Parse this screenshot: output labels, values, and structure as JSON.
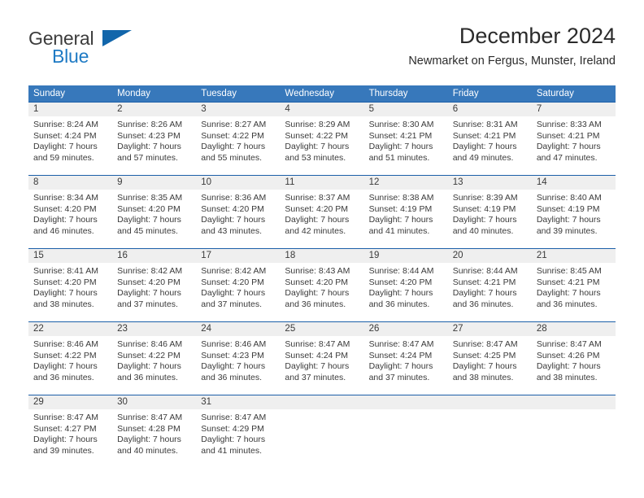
{
  "brand": {
    "name_part1": "General",
    "name_part2": "Blue",
    "triangle_color": "#1266ab",
    "blue_color": "#1e7ac4"
  },
  "header": {
    "title": "December 2024",
    "subtitle": "Newmarket on Fergus, Munster, Ireland"
  },
  "theme": {
    "header_blue": "#3778bb",
    "rule_blue": "#1c5fa8",
    "date_band_gray": "#efefef"
  },
  "weekdays": [
    "Sunday",
    "Monday",
    "Tuesday",
    "Wednesday",
    "Thursday",
    "Friday",
    "Saturday"
  ],
  "weeks": [
    [
      {
        "day": "1",
        "l1": "Sunrise: 8:24 AM",
        "l2": "Sunset: 4:24 PM",
        "l3": "Daylight: 7 hours",
        "l4": "and 59 minutes."
      },
      {
        "day": "2",
        "l1": "Sunrise: 8:26 AM",
        "l2": "Sunset: 4:23 PM",
        "l3": "Daylight: 7 hours",
        "l4": "and 57 minutes."
      },
      {
        "day": "3",
        "l1": "Sunrise: 8:27 AM",
        "l2": "Sunset: 4:22 PM",
        "l3": "Daylight: 7 hours",
        "l4": "and 55 minutes."
      },
      {
        "day": "4",
        "l1": "Sunrise: 8:29 AM",
        "l2": "Sunset: 4:22 PM",
        "l3": "Daylight: 7 hours",
        "l4": "and 53 minutes."
      },
      {
        "day": "5",
        "l1": "Sunrise: 8:30 AM",
        "l2": "Sunset: 4:21 PM",
        "l3": "Daylight: 7 hours",
        "l4": "and 51 minutes."
      },
      {
        "day": "6",
        "l1": "Sunrise: 8:31 AM",
        "l2": "Sunset: 4:21 PM",
        "l3": "Daylight: 7 hours",
        "l4": "and 49 minutes."
      },
      {
        "day": "7",
        "l1": "Sunrise: 8:33 AM",
        "l2": "Sunset: 4:21 PM",
        "l3": "Daylight: 7 hours",
        "l4": "and 47 minutes."
      }
    ],
    [
      {
        "day": "8",
        "l1": "Sunrise: 8:34 AM",
        "l2": "Sunset: 4:20 PM",
        "l3": "Daylight: 7 hours",
        "l4": "and 46 minutes."
      },
      {
        "day": "9",
        "l1": "Sunrise: 8:35 AM",
        "l2": "Sunset: 4:20 PM",
        "l3": "Daylight: 7 hours",
        "l4": "and 45 minutes."
      },
      {
        "day": "10",
        "l1": "Sunrise: 8:36 AM",
        "l2": "Sunset: 4:20 PM",
        "l3": "Daylight: 7 hours",
        "l4": "and 43 minutes."
      },
      {
        "day": "11",
        "l1": "Sunrise: 8:37 AM",
        "l2": "Sunset: 4:20 PM",
        "l3": "Daylight: 7 hours",
        "l4": "and 42 minutes."
      },
      {
        "day": "12",
        "l1": "Sunrise: 8:38 AM",
        "l2": "Sunset: 4:19 PM",
        "l3": "Daylight: 7 hours",
        "l4": "and 41 minutes."
      },
      {
        "day": "13",
        "l1": "Sunrise: 8:39 AM",
        "l2": "Sunset: 4:19 PM",
        "l3": "Daylight: 7 hours",
        "l4": "and 40 minutes."
      },
      {
        "day": "14",
        "l1": "Sunrise: 8:40 AM",
        "l2": "Sunset: 4:19 PM",
        "l3": "Daylight: 7 hours",
        "l4": "and 39 minutes."
      }
    ],
    [
      {
        "day": "15",
        "l1": "Sunrise: 8:41 AM",
        "l2": "Sunset: 4:20 PM",
        "l3": "Daylight: 7 hours",
        "l4": "and 38 minutes."
      },
      {
        "day": "16",
        "l1": "Sunrise: 8:42 AM",
        "l2": "Sunset: 4:20 PM",
        "l3": "Daylight: 7 hours",
        "l4": "and 37 minutes."
      },
      {
        "day": "17",
        "l1": "Sunrise: 8:42 AM",
        "l2": "Sunset: 4:20 PM",
        "l3": "Daylight: 7 hours",
        "l4": "and 37 minutes."
      },
      {
        "day": "18",
        "l1": "Sunrise: 8:43 AM",
        "l2": "Sunset: 4:20 PM",
        "l3": "Daylight: 7 hours",
        "l4": "and 36 minutes."
      },
      {
        "day": "19",
        "l1": "Sunrise: 8:44 AM",
        "l2": "Sunset: 4:20 PM",
        "l3": "Daylight: 7 hours",
        "l4": "and 36 minutes."
      },
      {
        "day": "20",
        "l1": "Sunrise: 8:44 AM",
        "l2": "Sunset: 4:21 PM",
        "l3": "Daylight: 7 hours",
        "l4": "and 36 minutes."
      },
      {
        "day": "21",
        "l1": "Sunrise: 8:45 AM",
        "l2": "Sunset: 4:21 PM",
        "l3": "Daylight: 7 hours",
        "l4": "and 36 minutes."
      }
    ],
    [
      {
        "day": "22",
        "l1": "Sunrise: 8:46 AM",
        "l2": "Sunset: 4:22 PM",
        "l3": "Daylight: 7 hours",
        "l4": "and 36 minutes."
      },
      {
        "day": "23",
        "l1": "Sunrise: 8:46 AM",
        "l2": "Sunset: 4:22 PM",
        "l3": "Daylight: 7 hours",
        "l4": "and 36 minutes."
      },
      {
        "day": "24",
        "l1": "Sunrise: 8:46 AM",
        "l2": "Sunset: 4:23 PM",
        "l3": "Daylight: 7 hours",
        "l4": "and 36 minutes."
      },
      {
        "day": "25",
        "l1": "Sunrise: 8:47 AM",
        "l2": "Sunset: 4:24 PM",
        "l3": "Daylight: 7 hours",
        "l4": "and 37 minutes."
      },
      {
        "day": "26",
        "l1": "Sunrise: 8:47 AM",
        "l2": "Sunset: 4:24 PM",
        "l3": "Daylight: 7 hours",
        "l4": "and 37 minutes."
      },
      {
        "day": "27",
        "l1": "Sunrise: 8:47 AM",
        "l2": "Sunset: 4:25 PM",
        "l3": "Daylight: 7 hours",
        "l4": "and 38 minutes."
      },
      {
        "day": "28",
        "l1": "Sunrise: 8:47 AM",
        "l2": "Sunset: 4:26 PM",
        "l3": "Daylight: 7 hours",
        "l4": "and 38 minutes."
      }
    ],
    [
      {
        "day": "29",
        "l1": "Sunrise: 8:47 AM",
        "l2": "Sunset: 4:27 PM",
        "l3": "Daylight: 7 hours",
        "l4": "and 39 minutes."
      },
      {
        "day": "30",
        "l1": "Sunrise: 8:47 AM",
        "l2": "Sunset: 4:28 PM",
        "l3": "Daylight: 7 hours",
        "l4": "and 40 minutes."
      },
      {
        "day": "31",
        "l1": "Sunrise: 8:47 AM",
        "l2": "Sunset: 4:29 PM",
        "l3": "Daylight: 7 hours",
        "l4": "and 41 minutes."
      },
      {
        "day": "",
        "l1": "",
        "l2": "",
        "l3": "",
        "l4": ""
      },
      {
        "day": "",
        "l1": "",
        "l2": "",
        "l3": "",
        "l4": ""
      },
      {
        "day": "",
        "l1": "",
        "l2": "",
        "l3": "",
        "l4": ""
      },
      {
        "day": "",
        "l1": "",
        "l2": "",
        "l3": "",
        "l4": ""
      }
    ]
  ]
}
